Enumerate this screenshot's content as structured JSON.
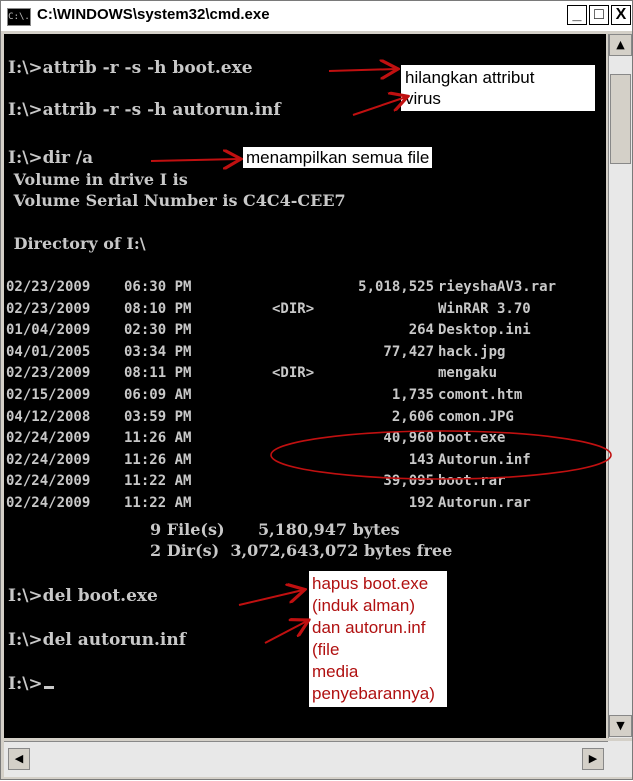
{
  "window": {
    "title": "C:\\WINDOWS\\system32\\cmd.exe",
    "icon_label": "C:\\.",
    "buttons": {
      "minimize": "_",
      "maximize": "□",
      "close": "X"
    }
  },
  "console": {
    "commands": [
      "I:\\>attrib -r -s -h boot.exe",
      "I:\\>attrib -r -s -h autorun.inf",
      "I:\\>dir /a"
    ],
    "volume_line": " Volume in drive I is",
    "serial_line": " Volume Serial Number is C4C4-CEE7",
    "directory_line": " Directory of I:\\",
    "entries": [
      {
        "date": "02/23/2009",
        "time": "06:30 PM",
        "dir": "",
        "size": "5,018,525",
        "name": "rieyshaAV3.rar"
      },
      {
        "date": "02/23/2009",
        "time": "08:10 PM",
        "dir": "<DIR>",
        "size": "",
        "name": "WinRAR 3.70"
      },
      {
        "date": "01/04/2009",
        "time": "02:30 PM",
        "dir": "",
        "size": "264",
        "name": "Desktop.ini"
      },
      {
        "date": "04/01/2005",
        "time": "03:34 PM",
        "dir": "",
        "size": "77,427",
        "name": "hack.jpg"
      },
      {
        "date": "02/23/2009",
        "time": "08:11 PM",
        "dir": "<DIR>",
        "size": "",
        "name": "mengaku"
      },
      {
        "date": "02/15/2009",
        "time": "06:09 AM",
        "dir": "",
        "size": "1,735",
        "name": "comont.htm"
      },
      {
        "date": "04/12/2008",
        "time": "03:59 PM",
        "dir": "",
        "size": "2,606",
        "name": "comon.JPG"
      },
      {
        "date": "02/24/2009",
        "time": "11:26 AM",
        "dir": "",
        "size": "40,960",
        "name": "boot.exe"
      },
      {
        "date": "02/24/2009",
        "time": "11:26 AM",
        "dir": "",
        "size": "143",
        "name": "Autorun.inf"
      },
      {
        "date": "02/24/2009",
        "time": "11:22 AM",
        "dir": "",
        "size": "39,095",
        "name": "boot.rar"
      },
      {
        "date": "02/24/2009",
        "time": "11:22 AM",
        "dir": "",
        "size": "192",
        "name": "Autorun.rar"
      }
    ],
    "summary_files": "9 File(s)      5,180,947 bytes",
    "summary_dirs": "2 Dir(s)  3,072,643,072 bytes free",
    "del_commands": [
      "I:\\>del boot.exe",
      "I:\\>del autorun.inf"
    ],
    "prompt": "I:\\>"
  },
  "annotations": {
    "attrib_note": [
      "hilangkan attribut",
      "virus"
    ],
    "dir_note": "menampilkan semua file",
    "del_note": [
      "hapus  boot.exe",
      "(induk alman)",
      "dan autorun.inf",
      "(file",
      "media",
      "penyebarannya)"
    ]
  },
  "colors": {
    "console_bg": "#000000",
    "console_text": "#c8c8c8",
    "annotation_red": "#b01010"
  }
}
